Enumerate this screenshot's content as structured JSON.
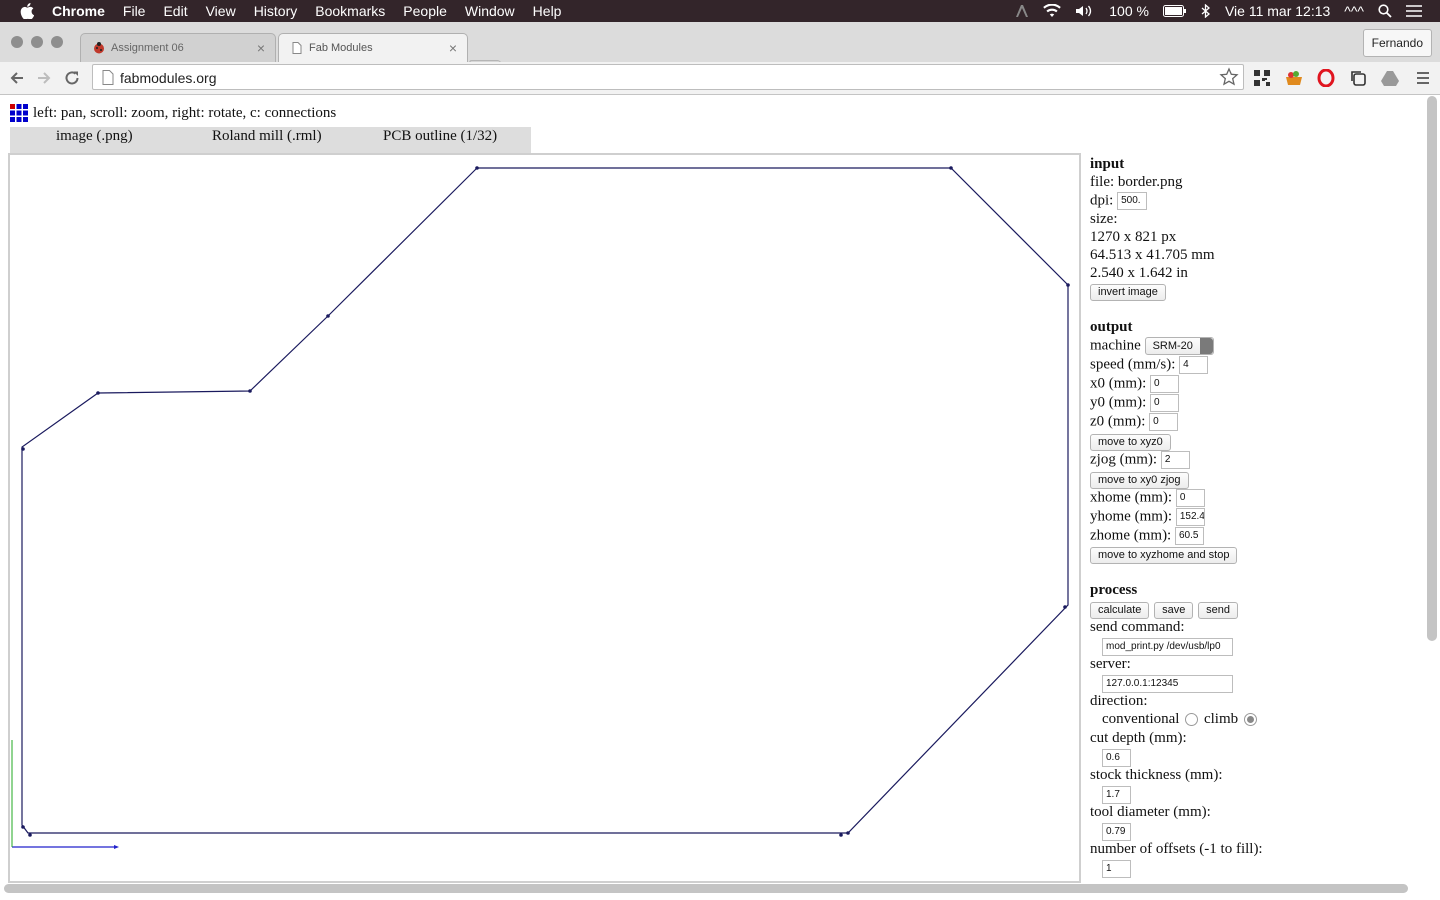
{
  "menubar": {
    "app": "Chrome",
    "items": [
      "File",
      "Edit",
      "View",
      "History",
      "Bookmarks",
      "People",
      "Window",
      "Help"
    ],
    "battery": "100 %",
    "datetime": "Vie 11 mar  12:13",
    "extra": "^^^"
  },
  "browser": {
    "tabs": [
      {
        "title": "Assignment 06"
      },
      {
        "title": "Fab Modules"
      }
    ],
    "user": "Fernando",
    "url": "fabmodules.org"
  },
  "page": {
    "hint": "left: pan, scroll: zoom, right: rotate, c: connections",
    "module_tabs": [
      "image (.png)",
      "Roland mill (.rml)",
      "PCB outline (1/32)"
    ]
  },
  "panel": {
    "input": {
      "header": "input",
      "file": "file: border.png",
      "dpi_label": "dpi:",
      "dpi": "500.",
      "size_label": "size:",
      "size_px": "1270 x 821 px",
      "size_mm": "64.513 x 41.705 mm",
      "size_in": "2.540 x 1.642 in",
      "invert": "invert image"
    },
    "output": {
      "header": "output",
      "machine_label": "machine",
      "machine": "SRM-20",
      "speed_label": "speed (mm/s):",
      "speed": "4",
      "x0_label": "x0 (mm):",
      "x0": "0",
      "y0_label": "y0 (mm):",
      "y0": "0",
      "z0_label": "z0 (mm):",
      "z0": "0",
      "move_xyz0": "move to xyz0",
      "zjog_label": "zjog (mm):",
      "zjog": "2",
      "move_xy0": "move to xy0 zjog",
      "xhome_label": "xhome (mm):",
      "xhome": "0",
      "yhome_label": "yhome (mm):",
      "yhome": "152.4",
      "zhome_label": "zhome (mm):",
      "zhome": "60.5",
      "move_home": "move to xyzhome and stop"
    },
    "process": {
      "header": "process",
      "calculate": "calculate",
      "save": "save",
      "send": "send",
      "send_cmd_label": "send command:",
      "send_cmd": "mod_print.py /dev/usb/lp0",
      "server_label": "server:",
      "server": "127.0.0.1:12345",
      "direction_label": "direction:",
      "conventional": "conventional",
      "climb": "climb",
      "cut_depth_label": "cut depth (mm):",
      "cut_depth": "0.6",
      "stock_label": "stock thickness (mm):",
      "stock": "1.7",
      "tool_label": "tool diameter (mm):",
      "tool": "0.79",
      "offsets_label": "number of offsets (-1 to fill):",
      "offsets": "1"
    }
  },
  "colors": {
    "menubar_bg": "#33252a",
    "toolpath": "#1a1a5e",
    "axis_x": "#2222cc",
    "axis_y": "#22aa22"
  }
}
